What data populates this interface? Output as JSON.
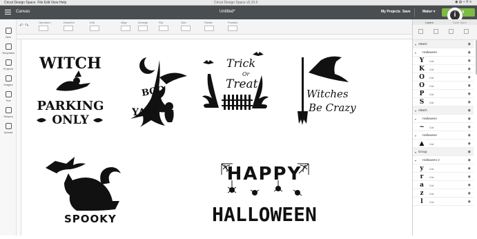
{
  "system_bar": {
    "app": "Cricut Design Space",
    "menus": "File  Edit  View  Help",
    "window_title": "Cricut Design Space  v5.10.0"
  },
  "header": {
    "canvas_label": "Canvas",
    "document_title": "Untitled*",
    "my_projects": "My Projects",
    "save": "Save",
    "machine": "Maker",
    "make_it": "Make It",
    "info": "i"
  },
  "toolbar": {
    "undo_redo": "↶ ↷",
    "groups": [
      "Operation",
      "Deselect",
      "Edit",
      "Align",
      "Arrange",
      "Flip",
      "Size",
      "Rotate",
      "Position"
    ]
  },
  "left_nav": [
    {
      "label": "New",
      "icon": "plus-icon"
    },
    {
      "label": "Templates",
      "icon": "shirt-icon"
    },
    {
      "label": "Projects",
      "icon": "projects-icon"
    },
    {
      "label": "Images",
      "icon": "image-icon"
    },
    {
      "label": "Text",
      "icon": "text-icon"
    },
    {
      "label": "Shapes",
      "icon": "shapes-icon"
    },
    {
      "label": "Upload",
      "icon": "upload-icon"
    }
  ],
  "panel": {
    "tab_layers": "Layers",
    "tab_color_sync": "Color Sync"
  },
  "layers": [
    {
      "type": "group",
      "name": "Attach"
    },
    {
      "type": "sub",
      "name": "Halloween"
    },
    {
      "type": "item",
      "glyph": "Y",
      "op": "Cut"
    },
    {
      "type": "item",
      "glyph": "K",
      "op": "Cut"
    },
    {
      "type": "item",
      "glyph": "O",
      "op": "Cut"
    },
    {
      "type": "item",
      "glyph": "O",
      "op": "Cut"
    },
    {
      "type": "item",
      "glyph": "P",
      "op": "Cut"
    },
    {
      "type": "item",
      "glyph": "S",
      "op": "Cut"
    },
    {
      "type": "group",
      "name": "Attach"
    },
    {
      "type": "sub",
      "name": "Halloween"
    },
    {
      "type": "item",
      "glyph": "~",
      "op": "Cut"
    },
    {
      "type": "sub",
      "name": "Halloween"
    },
    {
      "type": "item",
      "glyph": "▲",
      "op": "Cut"
    },
    {
      "type": "group",
      "name": "Group"
    },
    {
      "type": "sub",
      "name": "Halloween 2"
    },
    {
      "type": "item",
      "glyph": "y",
      "op": "Cut"
    },
    {
      "type": "item",
      "glyph": "r",
      "op": "Cut"
    },
    {
      "type": "item",
      "glyph": "a",
      "op": "Cut"
    },
    {
      "type": "item",
      "glyph": "z",
      "op": "Cut"
    },
    {
      "type": "item",
      "glyph": "l",
      "op": "Cut"
    }
  ],
  "designs": {
    "witch_parking": [
      "WITCH",
      "PARKING",
      "ONLY"
    ],
    "boo_yall": [
      "BOO",
      "YALL"
    ],
    "trick_or_treat": [
      "Trick",
      "Or",
      "Treat"
    ],
    "witches_crazy": [
      "Witches",
      "Be Crazy"
    ],
    "spooky": "SPOOKY",
    "happy_halloween": [
      "HAPPY",
      "HALLOWEEN"
    ]
  },
  "colors": {
    "header": "#4b4e50",
    "make_it": "#7dbb42",
    "design": "#111111"
  }
}
